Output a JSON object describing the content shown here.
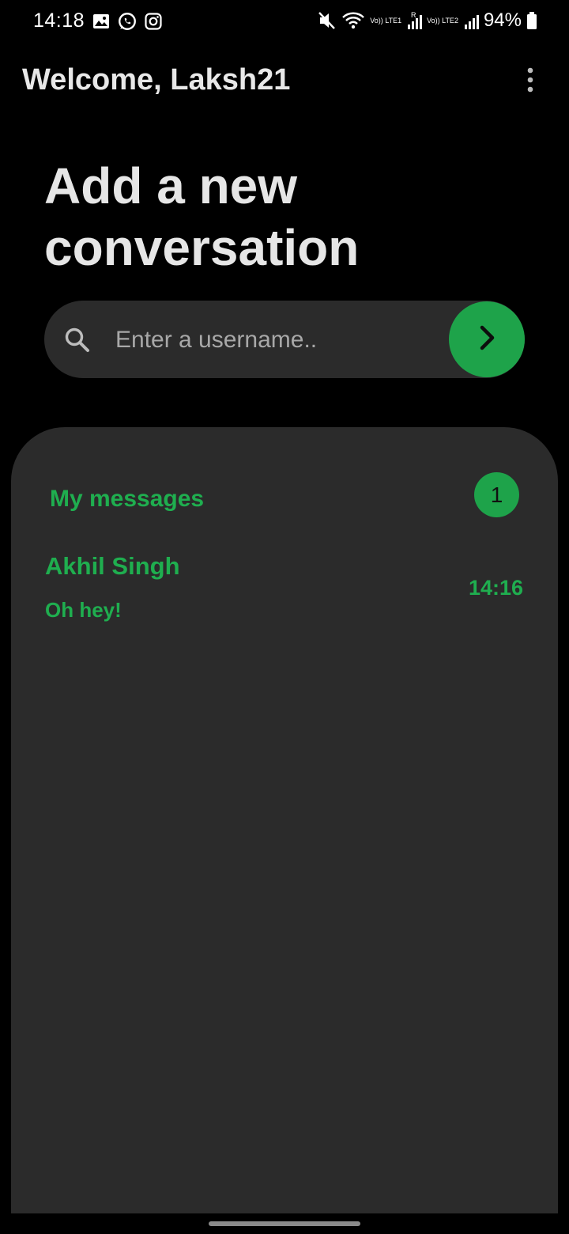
{
  "status_bar": {
    "time": "14:18",
    "app_icons": [
      "gallery-icon",
      "whatsapp-icon",
      "instagram-icon"
    ],
    "sim1_label": "Vo)) LTE1",
    "sim1_roaming": "R",
    "sim2_label": "Vo)) LTE2",
    "battery": "94%"
  },
  "header": {
    "welcome": "Welcome, Laksh21"
  },
  "title": {
    "line1": "Add a new",
    "line2": "conversation"
  },
  "search": {
    "placeholder": "Enter a username..",
    "value": ""
  },
  "messages": {
    "heading": "My messages",
    "count": "1",
    "items": [
      {
        "name": "Akhil Singh",
        "preview": "Oh hey!",
        "time": "14:16"
      }
    ]
  },
  "colors": {
    "background": "#000000",
    "panel": "#2b2b2b",
    "accent": "#1ea34a",
    "accent_text": "#1fae4f"
  }
}
